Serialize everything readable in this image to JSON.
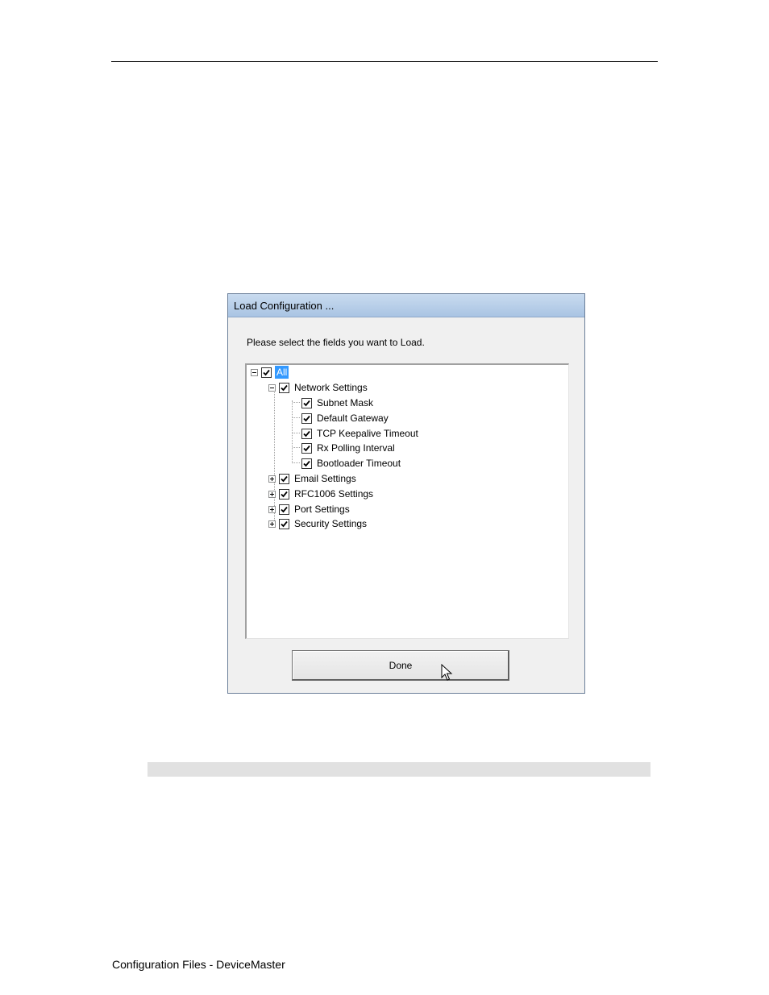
{
  "page": {
    "footer": "Configuration Files - DeviceMaster"
  },
  "dialog": {
    "title": "Load Configuration ...",
    "prompt": "Please select the fields you want to Load.",
    "done_label": "Done",
    "tree": {
      "root": {
        "label": "All",
        "checked": true,
        "expanded": true,
        "selected": true
      },
      "network": {
        "label": "Network Settings",
        "checked": true,
        "expanded": true,
        "children": [
          {
            "label": "Subnet Mask",
            "checked": true
          },
          {
            "label": "Default Gateway",
            "checked": true
          },
          {
            "label": "TCP Keepalive Timeout",
            "checked": true
          },
          {
            "label": "Rx Polling Interval",
            "checked": true
          },
          {
            "label": "Bootloader Timeout",
            "checked": true
          }
        ]
      },
      "email": {
        "label": "Email Settings",
        "checked": true,
        "expanded": false
      },
      "rfc1006": {
        "label": "RFC1006 Settings",
        "checked": true,
        "expanded": false
      },
      "port": {
        "label": "Port Settings",
        "checked": true,
        "expanded": false
      },
      "security": {
        "label": "Security Settings",
        "checked": true,
        "expanded": false
      }
    }
  },
  "icons": {
    "check": "checkmark-icon",
    "expand": "plus-box-icon",
    "collapse": "minus-box-icon",
    "cursor": "arrow-cursor-icon"
  },
  "colors": {
    "selection": "#3399ff",
    "titlebar": "#b9d1ea"
  }
}
